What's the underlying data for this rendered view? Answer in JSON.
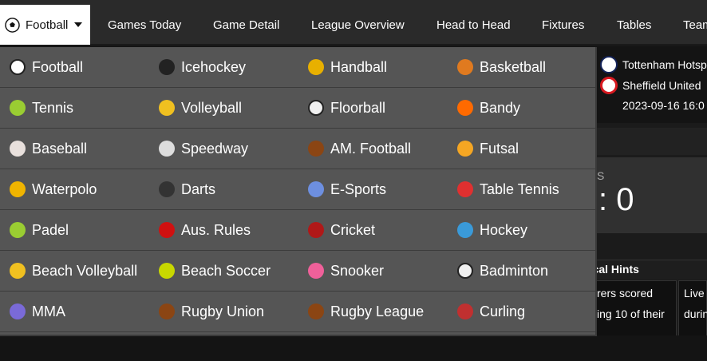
{
  "nav": {
    "selected_sport": "Football",
    "links": [
      "Games Today",
      "Game Detail",
      "League Overview",
      "Head to Head",
      "Fixtures",
      "Tables",
      "Team"
    ]
  },
  "match": {
    "home_team": "Tottenham Hotsp",
    "away_team": "Sheffield United",
    "datetime": "2023-09-16 16:0",
    "score_fragment": "S",
    "score_text": ": 0"
  },
  "hints": {
    "title": "tical Hints",
    "cards": [
      [
        "rers scored",
        "ing 10 of their"
      ],
      [
        "Live",
        "durin"
      ]
    ]
  },
  "sports_menu": {
    "rows": [
      [
        {
          "label": "Football",
          "icon": "soccer-ball-icon",
          "color": "#ffffff"
        },
        {
          "label": "Icehockey",
          "icon": "hockey-puck-icon",
          "color": "#222222"
        },
        {
          "label": "Handball",
          "icon": "handball-icon",
          "color": "#e8b000"
        },
        {
          "label": "Basketball",
          "icon": "basketball-icon",
          "color": "#e07a1f"
        }
      ],
      [
        {
          "label": "Tennis",
          "icon": "tennis-ball-icon",
          "color": "#9acd32"
        },
        {
          "label": "Volleyball",
          "icon": "volleyball-icon",
          "color": "#f0c020"
        },
        {
          "label": "Floorball",
          "icon": "floorball-icon",
          "color": "#f0f0f0"
        },
        {
          "label": "Bandy",
          "icon": "bandy-ball-icon",
          "color": "#ff6a00"
        }
      ],
      [
        {
          "label": "Baseball",
          "icon": "baseball-icon",
          "color": "#e8e0dc"
        },
        {
          "label": "Speedway",
          "icon": "speedway-helmet-icon",
          "color": "#dddddd"
        },
        {
          "label": "AM. Football",
          "icon": "american-football-icon",
          "color": "#8b4513"
        },
        {
          "label": "Futsal",
          "icon": "futsal-ball-icon",
          "color": "#f5a623"
        }
      ],
      [
        {
          "label": "Waterpolo",
          "icon": "waterpolo-ball-icon",
          "color": "#f0b400"
        },
        {
          "label": "Darts",
          "icon": "dartboard-icon",
          "color": "#333333"
        },
        {
          "label": "E-Sports",
          "icon": "gamepad-icon",
          "color": "#6d8fe0"
        },
        {
          "label": "Table Tennis",
          "icon": "table-tennis-paddle-icon",
          "color": "#e03030"
        }
      ],
      [
        {
          "label": "Padel",
          "icon": "padel-ball-icon",
          "color": "#9acd32"
        },
        {
          "label": "Aus. Rules",
          "icon": "aus-rules-ball-icon",
          "color": "#d01010"
        },
        {
          "label": "Cricket",
          "icon": "cricket-ball-icon",
          "color": "#b01818"
        },
        {
          "label": "Hockey",
          "icon": "field-hockey-icon",
          "color": "#3a9ad9"
        }
      ],
      [
        {
          "label": "Beach Volleyball",
          "icon": "beach-volleyball-icon",
          "color": "#f0c020"
        },
        {
          "label": "Beach Soccer",
          "icon": "beach-soccer-icon",
          "color": "#c8d800"
        },
        {
          "label": "Snooker",
          "icon": "snooker-ball-icon",
          "color": "#f0609a"
        },
        {
          "label": "Badminton",
          "icon": "shuttlecock-icon",
          "color": "#f0f0f0"
        }
      ],
      [
        {
          "label": "MMA",
          "icon": "mma-glove-icon",
          "color": "#7a6ad8"
        },
        {
          "label": "Rugby Union",
          "icon": "rugby-ball-icon",
          "color": "#8b4513"
        },
        {
          "label": "Rugby League",
          "icon": "rugby-league-ball-icon",
          "color": "#8b4513"
        },
        {
          "label": "Curling",
          "icon": "curling-stone-icon",
          "color": "#c03030"
        }
      ]
    ]
  }
}
